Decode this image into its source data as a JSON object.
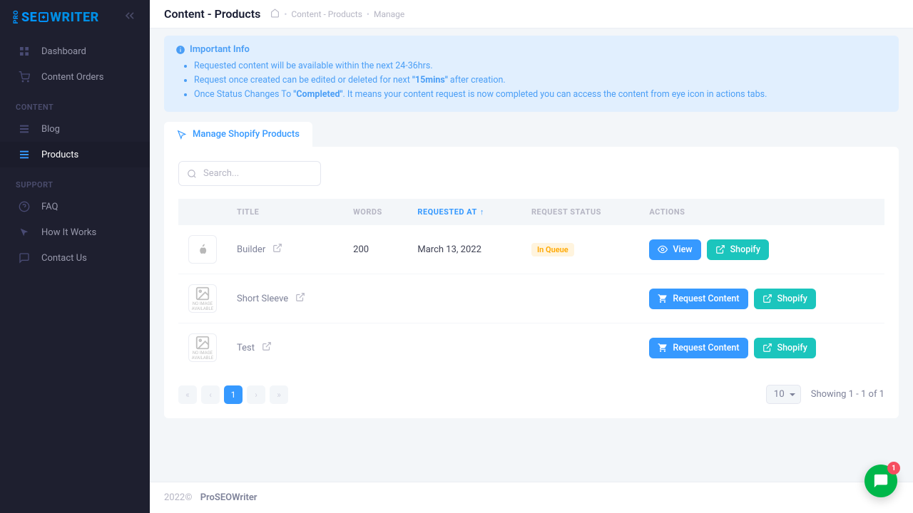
{
  "brand": {
    "pro": "PRO",
    "seo": "SE",
    "writer": "WRITER"
  },
  "sidebar": {
    "items_top": [
      {
        "label": "Dashboard"
      },
      {
        "label": "Content Orders"
      }
    ],
    "section_content": "CONTENT",
    "items_content": [
      {
        "label": "Blog"
      },
      {
        "label": "Products"
      }
    ],
    "section_support": "SUPPORT",
    "items_support": [
      {
        "label": "FAQ"
      },
      {
        "label": "How It Works"
      },
      {
        "label": "Contact Us"
      }
    ]
  },
  "header": {
    "title": "Content - Products",
    "crumb1": "Content - Products",
    "crumb2": "Manage"
  },
  "alert": {
    "title": "Important Info",
    "li1": "Requested content will be available within the next 24-36hrs.",
    "li2a": "Request once created can be edited or deleted for next ",
    "li2b": "\"15mins\"",
    "li2c": " after creation.",
    "li3a": "Once Status Changes To ",
    "li3b": "\"Completed\"",
    "li3c": ". It means your content request is now completed you can access the content from eye icon in actions tabs."
  },
  "tab": {
    "label": "Manage Shopify Products"
  },
  "search": {
    "placeholder": "Search..."
  },
  "columns": {
    "title": "TITLE",
    "words": "WORDS",
    "requested": "REQUESTED AT",
    "status": "REQUEST STATUS",
    "actions": "ACTIONS"
  },
  "rows": [
    {
      "title": "Builder",
      "words": "200",
      "requested": "March 13, 2022",
      "status": "In Queue",
      "has_status": true,
      "view": true
    },
    {
      "title": "Short Sleeve",
      "words": "",
      "requested": "",
      "status": "",
      "has_status": false,
      "view": false
    },
    {
      "title": "Test",
      "words": "",
      "requested": "",
      "status": "",
      "has_status": false,
      "view": false
    }
  ],
  "buttons": {
    "view": "View",
    "shopify": "Shopify",
    "request": "Request Content"
  },
  "noimg": "NO IMAGE AVAILABLE",
  "pagination": {
    "page": "1",
    "size": "10",
    "showing": "Showing 1 - 1 of 1"
  },
  "footer": {
    "year": "2022©",
    "brand": "ProSEOWriter"
  },
  "chat": {
    "badge": "1"
  }
}
